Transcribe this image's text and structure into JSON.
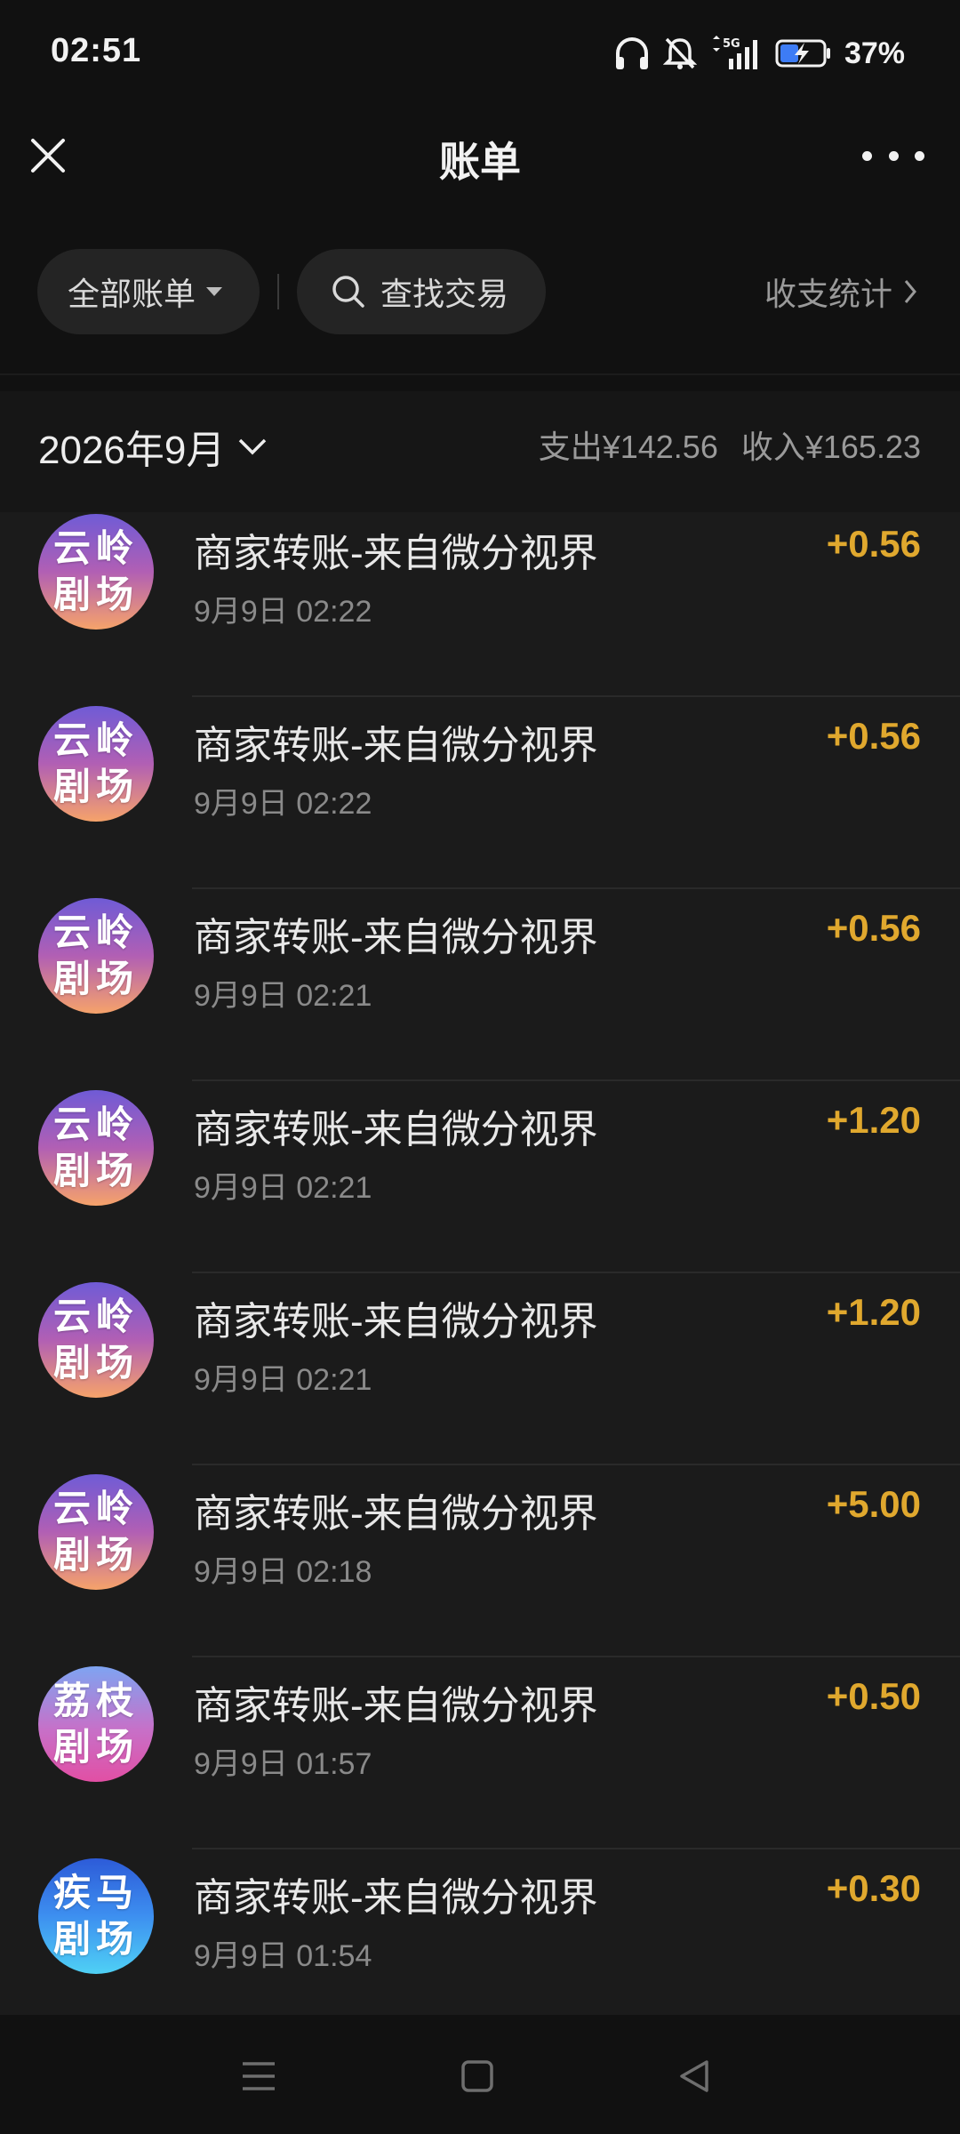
{
  "status": {
    "time": "02:51",
    "battery": "37%",
    "network": "5G"
  },
  "nav": {
    "title": "账单"
  },
  "filters": {
    "all_bills": "全部账单",
    "search": "查找交易",
    "stats": "收支统计"
  },
  "month": {
    "label": "2026年9月",
    "expense": "支出¥142.56",
    "income": "收入¥165.23"
  },
  "transactions": [
    {
      "avatar_top": "云岭",
      "avatar_bottom": "剧场",
      "avatar_style": "yunling",
      "title": "商家转账-来自微分视界",
      "time": "9月9日 02:22",
      "amount": "+0.56"
    },
    {
      "avatar_top": "云岭",
      "avatar_bottom": "剧场",
      "avatar_style": "yunling",
      "title": "商家转账-来自微分视界",
      "time": "9月9日 02:22",
      "amount": "+0.56"
    },
    {
      "avatar_top": "云岭",
      "avatar_bottom": "剧场",
      "avatar_style": "yunling",
      "title": "商家转账-来自微分视界",
      "time": "9月9日 02:21",
      "amount": "+0.56"
    },
    {
      "avatar_top": "云岭",
      "avatar_bottom": "剧场",
      "avatar_style": "yunling",
      "title": "商家转账-来自微分视界",
      "time": "9月9日 02:21",
      "amount": "+1.20"
    },
    {
      "avatar_top": "云岭",
      "avatar_bottom": "剧场",
      "avatar_style": "yunling",
      "title": "商家转账-来自微分视界",
      "time": "9月9日 02:21",
      "amount": "+1.20"
    },
    {
      "avatar_top": "云岭",
      "avatar_bottom": "剧场",
      "avatar_style": "yunling",
      "title": "商家转账-来自微分视界",
      "time": "9月9日 02:18",
      "amount": "+5.00"
    },
    {
      "avatar_top": "荔枝",
      "avatar_bottom": "剧场",
      "avatar_style": "lizhi",
      "title": "商家转账-来自微分视界",
      "time": "9月9日 01:57",
      "amount": "+0.50"
    },
    {
      "avatar_top": "疾马",
      "avatar_bottom": "剧场",
      "avatar_style": "jima",
      "title": "商家转账-来自微分视界",
      "time": "9月9日 01:54",
      "amount": "+0.30"
    }
  ],
  "icons": {
    "close": "close-icon",
    "more": "more-icon",
    "search": "search-icon",
    "dropdown": "caret-down-icon",
    "chevron": "chevron-right-icon",
    "menu": "menu-icon",
    "home": "home-icon",
    "back": "back-icon"
  },
  "colors": {
    "income": "#e0a82e",
    "background": "#111111"
  }
}
